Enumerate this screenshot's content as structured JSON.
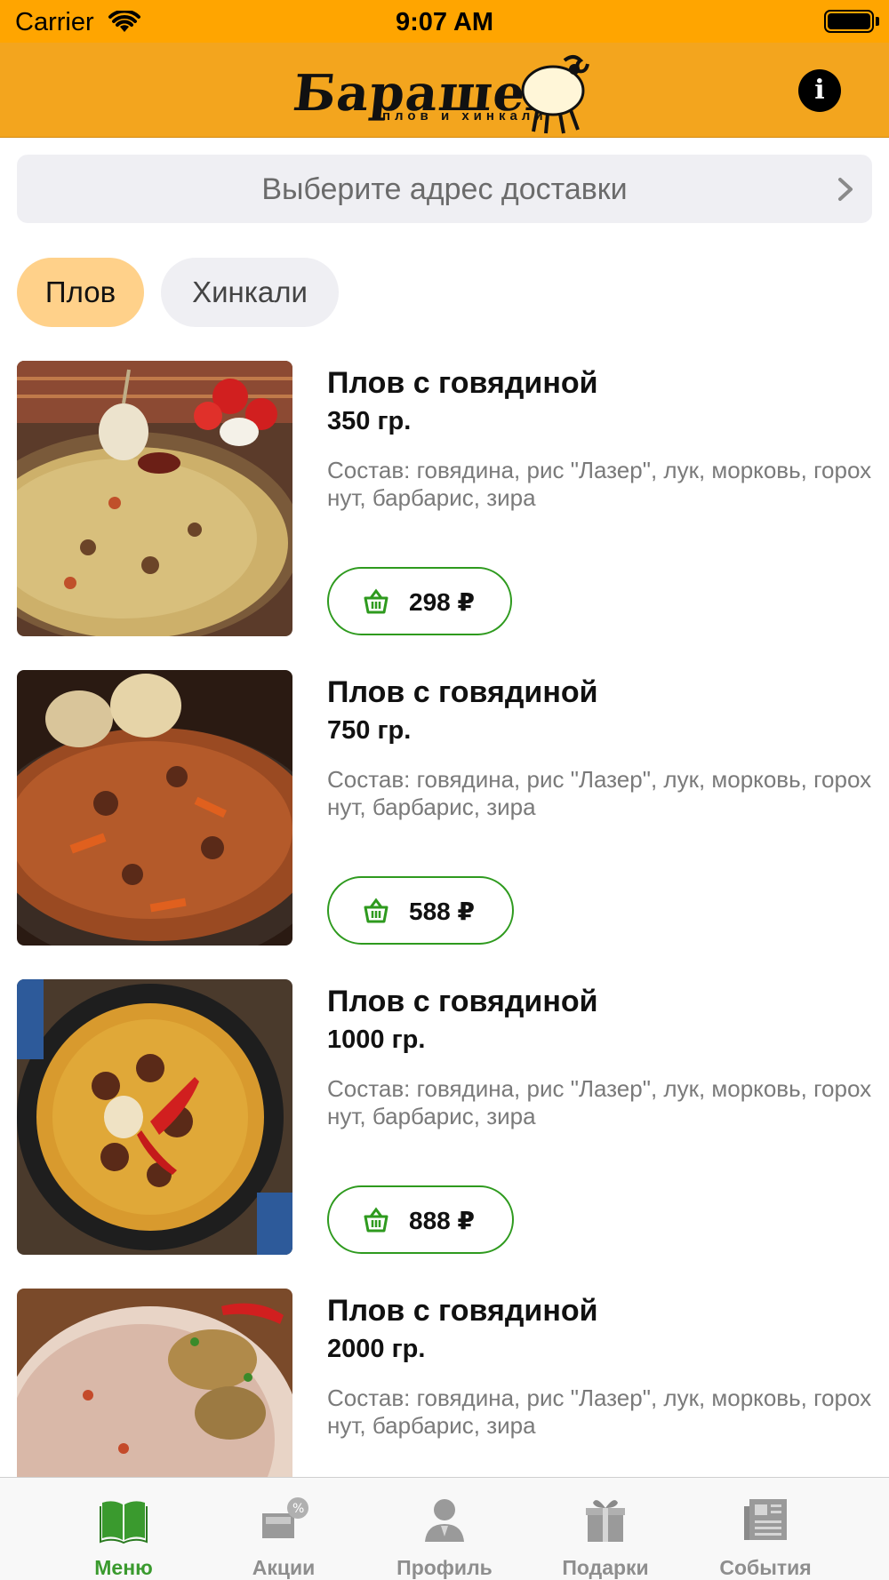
{
  "status_bar": {
    "carrier": "Carrier",
    "time": "9:07 AM"
  },
  "header": {
    "logo_title": "Барашек",
    "logo_subtitle": "плов и хинкали",
    "info_icon": "info-icon"
  },
  "address": {
    "placeholder": "Выберите адрес доставки"
  },
  "categories": [
    {
      "label": "Плов",
      "selected": true
    },
    {
      "label": "Хинкали",
      "selected": false
    }
  ],
  "menu_items": [
    {
      "title": "Плов с говядиной",
      "weight": "350 гр.",
      "description": "Состав: говядина, рис \"Лазер\", лук, морковь, горох нут, барбарис, зира",
      "price": "298 ₽"
    },
    {
      "title": "Плов с говядиной",
      "weight": "750 гр.",
      "description": "Состав: говядина, рис \"Лазер\", лук, морковь, горох нут, барбарис, зира",
      "price": "588 ₽"
    },
    {
      "title": "Плов с говядиной",
      "weight": "1000 гр.",
      "description": "Состав: говядина, рис \"Лазер\", лук, морковь, горох нут, барбарис, зира",
      "price": "888 ₽"
    },
    {
      "title": "Плов с говядиной",
      "weight": "2000 гр.",
      "description": "Состав: говядина, рис \"Лазер\", лук, морковь, горох нут, барбарис, зира",
      "price": ""
    }
  ],
  "tabs": [
    {
      "label": "Меню",
      "icon": "book-icon",
      "active": true
    },
    {
      "label": "Акции",
      "icon": "discount-icon",
      "active": false
    },
    {
      "label": "Профиль",
      "icon": "person-icon",
      "active": false
    },
    {
      "label": "Подарки",
      "icon": "gift-icon",
      "active": false
    },
    {
      "label": "События",
      "icon": "news-icon",
      "active": false
    }
  ],
  "colors": {
    "status_bar": "#FFA500",
    "header": "#F3A51E",
    "accent_green": "#2E9A1E",
    "chip_active": "#FFD18A",
    "chip_inactive": "#EFEFF3"
  }
}
